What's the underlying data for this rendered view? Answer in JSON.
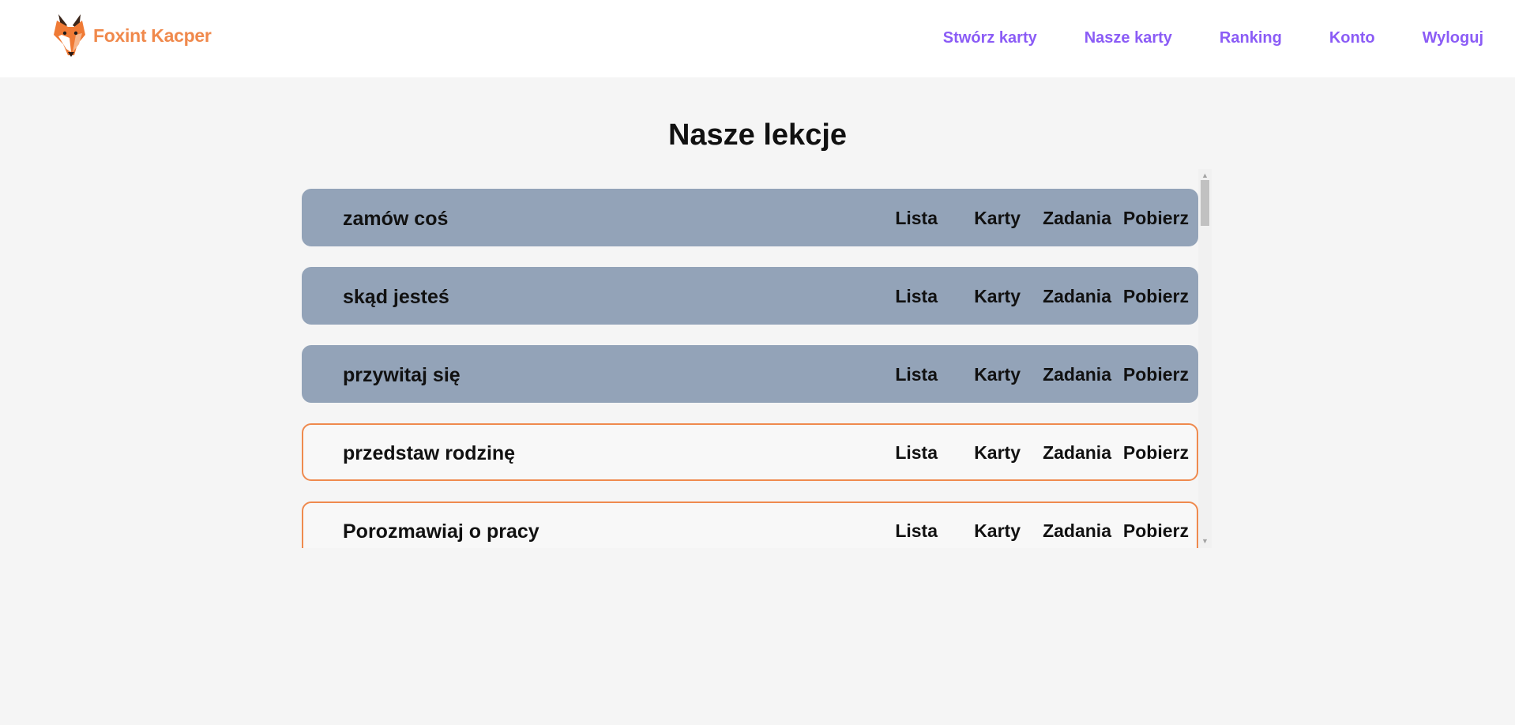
{
  "app": {
    "brand": "Foxint Kacper",
    "logo_icon": "fox-head-icon",
    "brand_color": "#f0894c",
    "nav_color": "#8b5cf6"
  },
  "nav": {
    "items": [
      {
        "label": "Stwórz karty"
      },
      {
        "label": "Nasze karty"
      },
      {
        "label": "Ranking"
      },
      {
        "label": "Konto"
      },
      {
        "label": "Wyloguj"
      }
    ]
  },
  "page": {
    "title": "Nasze lekcje"
  },
  "lessons": [
    {
      "title": "zamów coś",
      "status": "completed",
      "actions": [
        "Lista",
        "Karty",
        "Zadania",
        "Pobierz"
      ]
    },
    {
      "title": "skąd jesteś",
      "status": "completed",
      "actions": [
        "Lista",
        "Karty",
        "Zadania",
        "Pobierz"
      ]
    },
    {
      "title": "przywitaj się",
      "status": "completed",
      "actions": [
        "Lista",
        "Karty",
        "Zadania",
        "Pobierz"
      ]
    },
    {
      "title": "przedstaw rodzinę",
      "status": "pending",
      "actions": [
        "Lista",
        "Karty",
        "Zadania",
        "Pobierz"
      ]
    },
    {
      "title": "Porozmawiaj o pracy",
      "status": "pending",
      "actions": [
        "Lista",
        "Karty",
        "Zadania",
        "Pobierz"
      ]
    }
  ],
  "colors": {
    "completed_row": "#93a3b8",
    "pending_border": "#ef8a4e",
    "page_background": "#f5f5f5"
  }
}
